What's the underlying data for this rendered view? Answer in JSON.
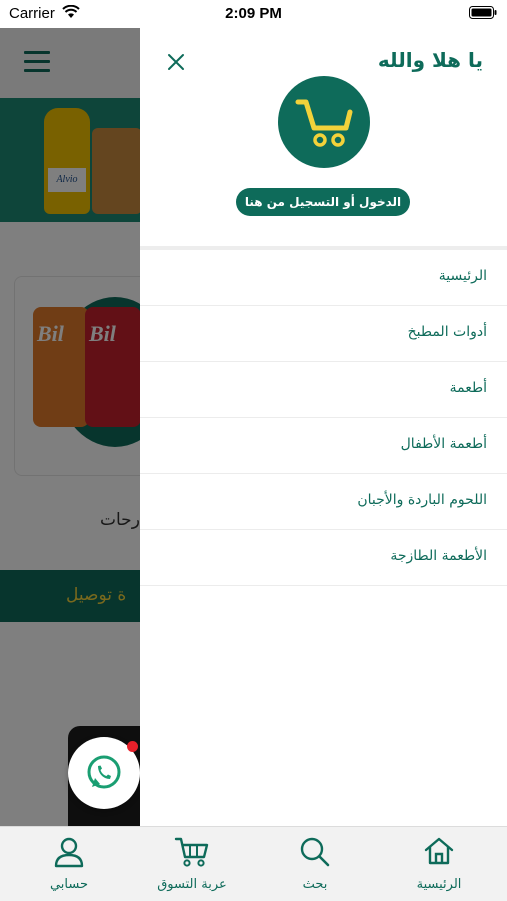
{
  "status_bar": {
    "carrier": "Carrier",
    "time": "2:09 PM"
  },
  "background": {
    "bottle_label": "Alvio",
    "chip_brand": "Bil",
    "section_text": "رحات",
    "strip_text": "ة توصيل"
  },
  "drawer": {
    "greeting": "يا هلا والله",
    "login_button": "الدخول أو التسجيل من هنا",
    "menu_items": [
      {
        "label": "الرئيسية"
      },
      {
        "label": "أدوات المطبخ"
      },
      {
        "label": "أطعمة"
      },
      {
        "label": "أطعمة الأطفال"
      },
      {
        "label": "اللحوم الباردة والأجبان"
      },
      {
        "label": "الأطعمة الطازجة"
      }
    ]
  },
  "bottom_nav": {
    "home": "الرئيسية",
    "search": "بحث",
    "cart": "عربة التسوق",
    "account": "حسابي"
  },
  "colors": {
    "brand_green": "#0e6b5a",
    "accent_yellow": "#f3d23a",
    "badge_red": "#e8202a"
  }
}
